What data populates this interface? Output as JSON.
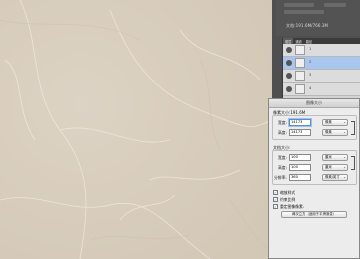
{
  "info": {
    "doc_size": "文档:191.6M/766.3M"
  },
  "layers_panel": {
    "tabs": [
      "图层",
      "通道",
      "路径"
    ],
    "rows": [
      {
        "name": "1"
      },
      {
        "name": "2"
      },
      {
        "name": "3"
      },
      {
        "name": "4"
      }
    ]
  },
  "dialog": {
    "title": "图像大小",
    "pixel_dims": {
      "title": "像素大小:191.6M",
      "width_label": "宽度:",
      "width_value": "14173",
      "width_unit": "像素",
      "height_label": "高度:",
      "height_value": "14173",
      "height_unit": "像素"
    },
    "doc_size": {
      "title": "文档大小:",
      "width_label": "宽度:",
      "width_value": "100",
      "width_unit": "厘米",
      "height_label": "高度:",
      "height_value": "100",
      "height_unit": "厘米",
      "resolution_label": "分辨率:",
      "resolution_value": "360",
      "resolution_unit": "像素/英寸"
    },
    "checkboxes": [
      {
        "label": "缩放样式",
        "checked": true
      },
      {
        "label": "约束比例",
        "checked": true
      },
      {
        "label": "重定图像像素:",
        "checked": true
      }
    ],
    "resample_method": "两次立方（适用于平滑渐变）"
  }
}
